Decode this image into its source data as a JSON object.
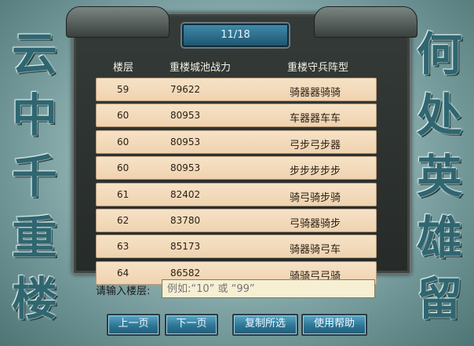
{
  "side_text": {
    "left": [
      "云",
      "中",
      "千",
      "重",
      "楼"
    ],
    "right": [
      "何",
      "处",
      "英",
      "雄",
      "留"
    ]
  },
  "page_indicator": "11/18",
  "table": {
    "headers": [
      "楼层",
      "重楼城池战力",
      "重楼守兵阵型"
    ],
    "rows": [
      [
        "59",
        "79622",
        "骑器器骑骑"
      ],
      [
        "60",
        "80953",
        "车器器车车"
      ],
      [
        "60",
        "80953",
        "弓步弓步器"
      ],
      [
        "60",
        "80953",
        "步步步步步"
      ],
      [
        "61",
        "82402",
        "骑弓骑步骑"
      ],
      [
        "62",
        "83780",
        "弓骑器骑步"
      ],
      [
        "63",
        "85173",
        "骑器骑弓车"
      ],
      [
        "64",
        "86582",
        "骑骑弓弓骑"
      ]
    ]
  },
  "input": {
    "label": "请输入楼层:",
    "placeholder": "例如:“10” 或 “99”"
  },
  "buttons": {
    "prev": "上一页",
    "next": "下一页",
    "copy": "复制所选",
    "help": "使用帮助"
  }
}
